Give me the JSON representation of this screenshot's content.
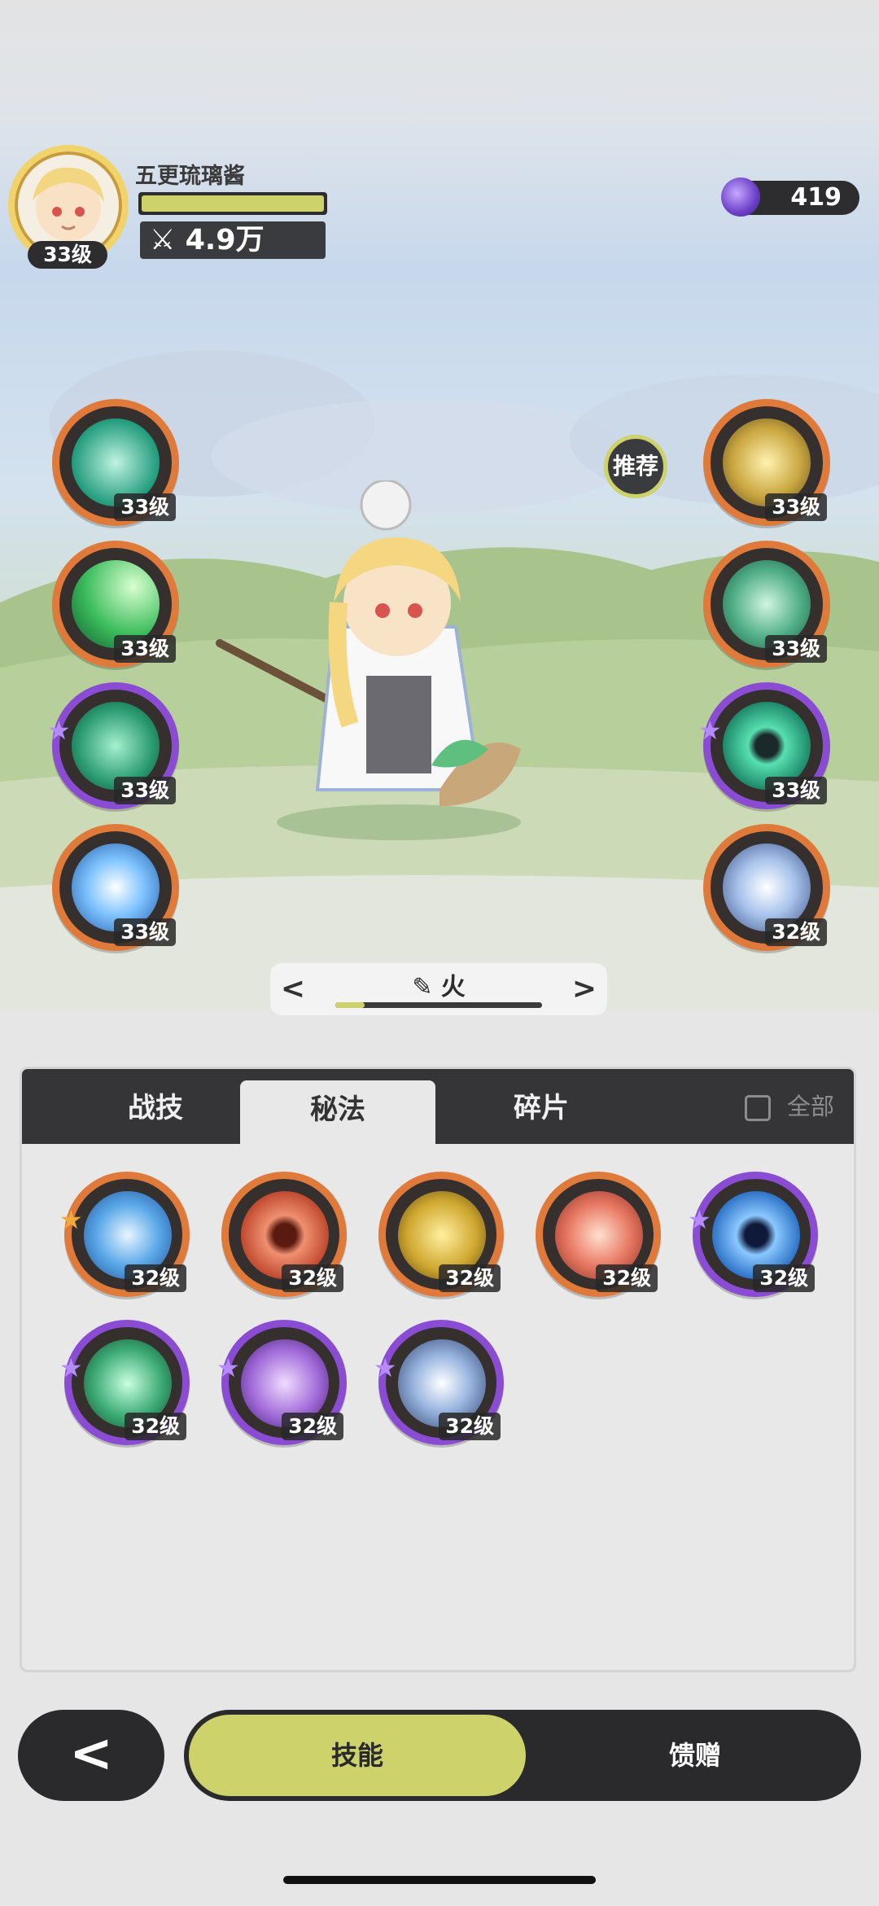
{
  "player": {
    "name": "五更琉璃酱",
    "avatar_level": "33级",
    "hp_fraction": 1.0,
    "power": "4.9万",
    "power_icon": "crossed-swords-icon"
  },
  "currency": {
    "value": "419",
    "icon": "purple-gem-icon"
  },
  "recommend_label": "推荐",
  "equipped_left": [
    {
      "level": "33级",
      "rarity": "orange",
      "icon": "whirlwind-icon"
    },
    {
      "level": "33级",
      "rarity": "orange",
      "icon": "leaf-slash-icon"
    },
    {
      "level": "33级",
      "rarity": "purple",
      "icon": "thorn-vine-icon",
      "star": "★"
    },
    {
      "level": "33级",
      "rarity": "orange",
      "icon": "ice-burst-icon"
    }
  ],
  "equipped_right": [
    {
      "level": "33级",
      "rarity": "orange",
      "icon": "golden-pillar-icon"
    },
    {
      "level": "33级",
      "rarity": "orange",
      "icon": "green-seal-icon"
    },
    {
      "level": "33级",
      "rarity": "purple",
      "icon": "green-spirit-icon",
      "star": "★"
    },
    {
      "level": "32级",
      "rarity": "orange",
      "icon": "frost-star-icon"
    }
  ],
  "element_switcher": {
    "prev": "<",
    "label": "火",
    "next": ">",
    "edit_icon": "pencil-icon",
    "progress": 0.14
  },
  "tabs": {
    "battle": "战技",
    "arcane": "秘法",
    "fragment": "碎片",
    "all": "全部"
  },
  "arcane_skills": [
    {
      "level": "32级",
      "rarity": "orange",
      "icon": "blue-crystal-icon",
      "star": "★",
      "star_color": "gold"
    },
    {
      "level": "32级",
      "rarity": "orange",
      "icon": "red-spirit-icon"
    },
    {
      "level": "32级",
      "rarity": "orange",
      "icon": "golden-claw-icon"
    },
    {
      "level": "32级",
      "rarity": "orange",
      "icon": "red-wave-icon"
    },
    {
      "level": "32级",
      "rarity": "purple",
      "icon": "blue-spirit-icon",
      "star": "★"
    },
    {
      "level": "32级",
      "rarity": "purple",
      "icon": "green-heart-icon",
      "star": "★"
    },
    {
      "level": "32级",
      "rarity": "purple",
      "icon": "purple-rune-icon",
      "star": "★"
    },
    {
      "level": "32级",
      "rarity": "purple",
      "icon": "blue-sparkle-icon",
      "star": "★"
    }
  ],
  "bottom": {
    "back": "<",
    "skill": "技能",
    "gift": "馈赠"
  },
  "colors": {
    "accent": "#cdd26a",
    "dark": "#2a2a2c",
    "orange_rim": "#e07a3a",
    "purple_rim": "#8a4cd2"
  }
}
